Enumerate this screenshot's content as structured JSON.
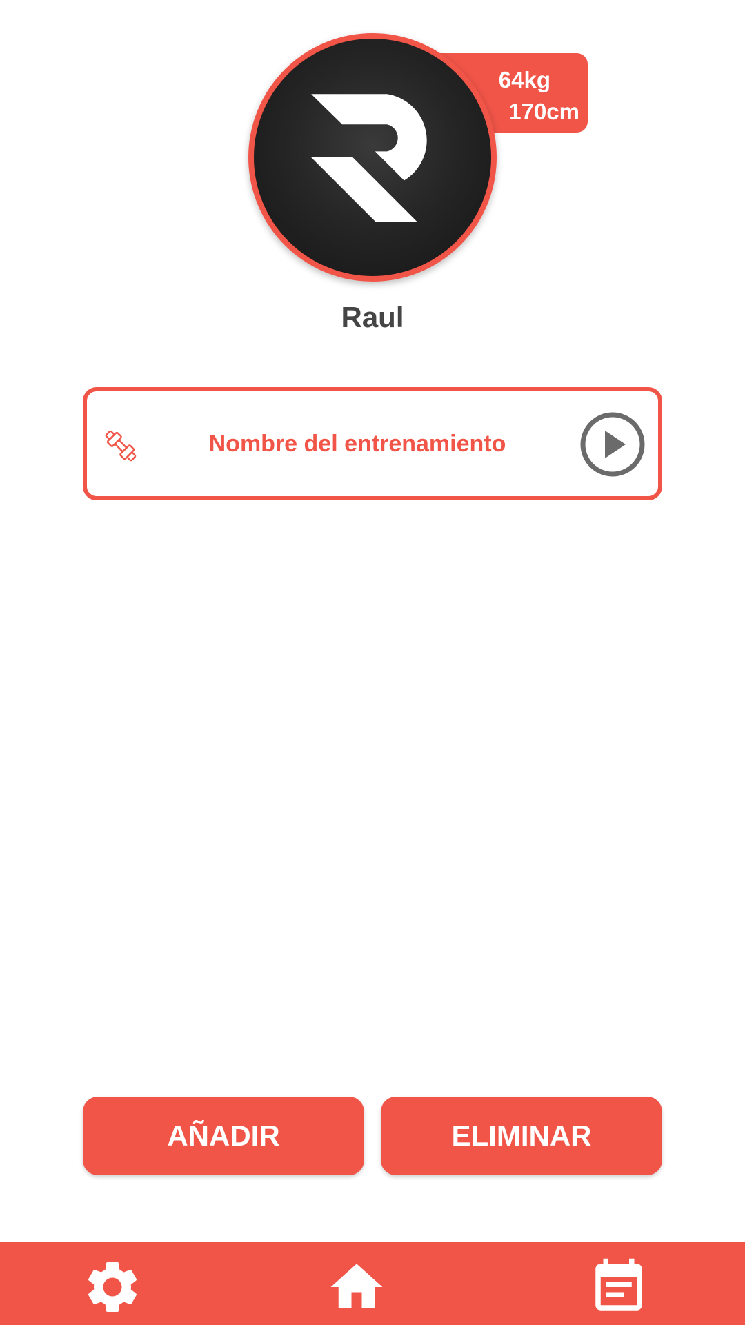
{
  "profile": {
    "name": "Raul",
    "weight": "64kg",
    "height": "170cm",
    "avatar_icon": "r-logo-icon"
  },
  "workout": {
    "name": "Nombre del entrenamiento",
    "leading_icon": "dumbbell-icon",
    "action_icon": "play-circle-icon"
  },
  "actions": {
    "add_label": "AÑADIR",
    "remove_label": "ELIMINAR"
  },
  "nav": {
    "items": [
      {
        "id": "settings",
        "icon": "gear-icon"
      },
      {
        "id": "home",
        "icon": "home-icon"
      },
      {
        "id": "calendar",
        "icon": "calendar-icon"
      }
    ]
  },
  "colors": {
    "accent": "#f05548",
    "text_dark": "#454545",
    "avatar_bg": "#262626",
    "play_icon": "#6b6b6b"
  }
}
